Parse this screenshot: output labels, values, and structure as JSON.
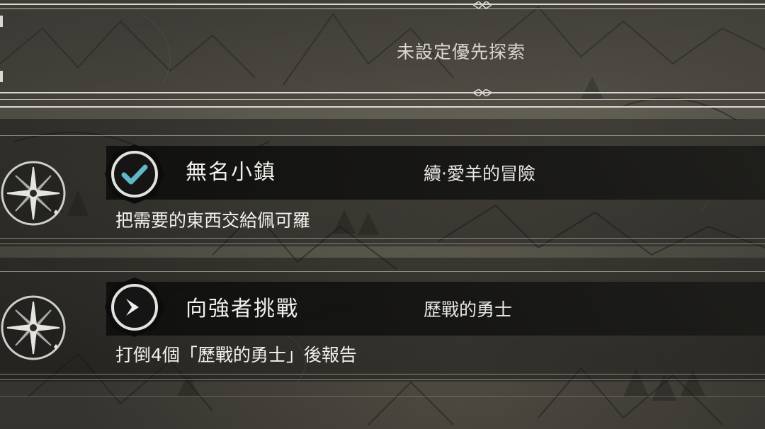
{
  "header": {
    "priority_status": "未設定優先探索"
  },
  "quests": [
    {
      "title": "無名小鎮",
      "category": "續‧愛羊的冒險",
      "description": "把需要的東西交給佩可羅",
      "status_icon": "checkmark-icon",
      "emblem_icon": "compass-star-icon"
    },
    {
      "title": "向強者挑戰",
      "category": "歷戰的勇士",
      "description": "打倒4個「歷戰的勇士」後報告",
      "status_icon": "chevron-right-icon",
      "emblem_icon": "compass-star-icon"
    }
  ],
  "colors": {
    "check_accent": "#5fb8c4",
    "line": "#d9d7d0",
    "text": "#f1efe9"
  }
}
